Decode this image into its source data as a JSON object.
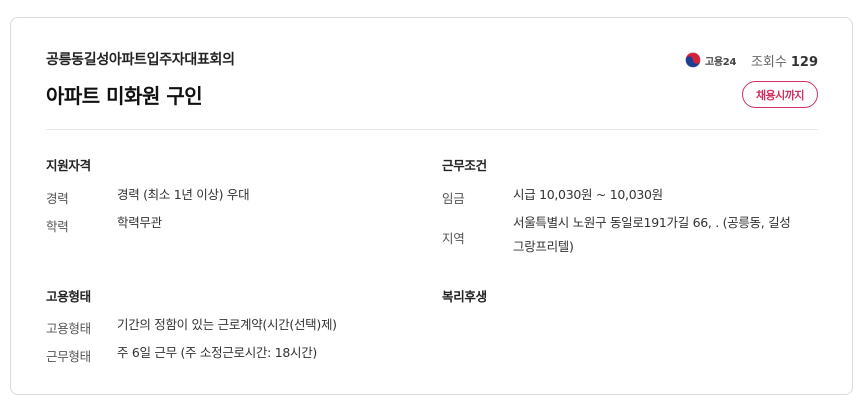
{
  "header": {
    "company": "공릉동길성아파트입주자대표회의",
    "title": "아파트 미화원 구인",
    "source_label": "고용24",
    "views_label": "조회수",
    "views_count": "129",
    "deadline_badge": "채용시까지"
  },
  "sections": {
    "qualification": {
      "title": "지원자격",
      "career_label": "경력",
      "career_value": "경력 (최소 1년 이상) 우대",
      "education_label": "학력",
      "education_value": "학력무관"
    },
    "conditions": {
      "title": "근무조건",
      "wage_label": "임금",
      "wage_value": "시급 10,030원 ~ 10,030원",
      "region_label": "지역",
      "region_line1": "서울특별시 노원구 동일로191가길 66, . (공릉동, 길성",
      "region_line2": "그랑프리텔)"
    },
    "employment": {
      "title": "고용형태",
      "type_label": "고용형태",
      "type_value": "기간의 정함이 있는 근로계약(시간(선택)제)",
      "work_label": "근무형태",
      "work_value": "주 6일 근무 (주 소정근로시간: 18시간)"
    },
    "welfare": {
      "title": "복리후생"
    }
  },
  "colors": {
    "accent": "#d0305f",
    "border": "#dcdcdc"
  }
}
